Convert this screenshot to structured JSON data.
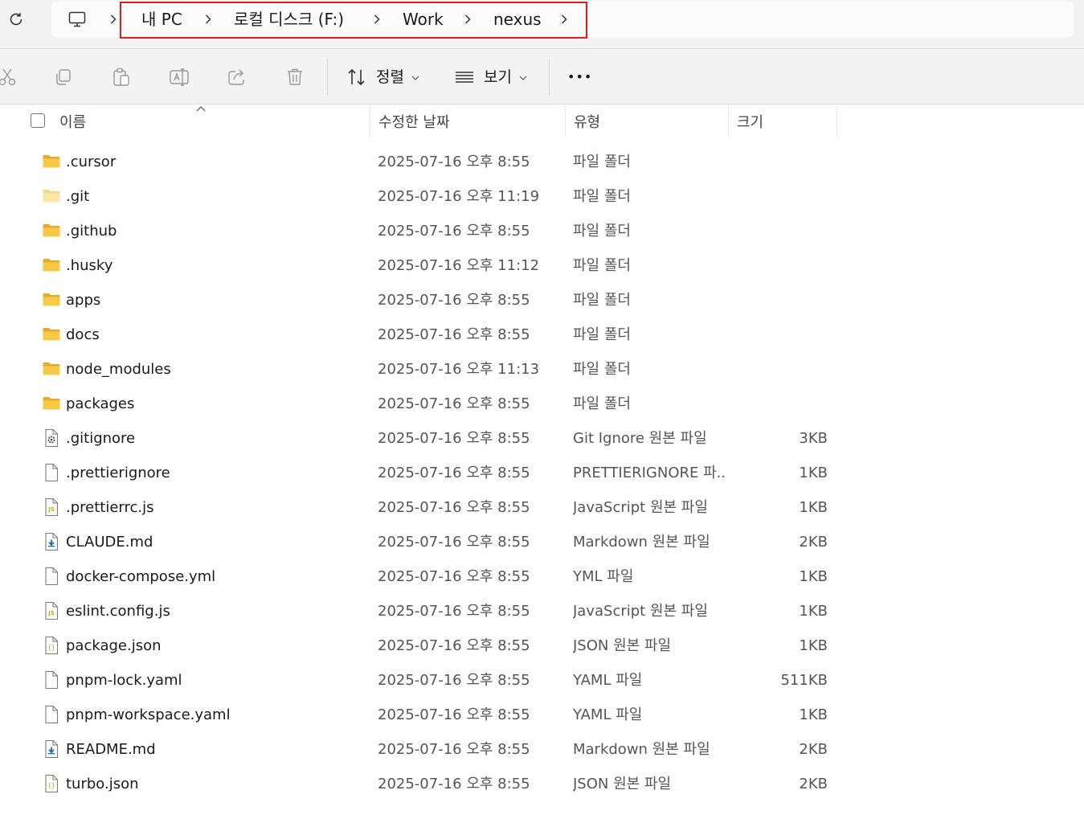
{
  "breadcrumb": {
    "items": [
      "내 PC",
      "로컬 디스크 (F:)",
      "Work",
      "nexus"
    ]
  },
  "icons": {
    "refresh": "refresh-icon",
    "pc": "computer-icon",
    "cut": "cut-icon",
    "copy": "copy-icon",
    "paste": "paste-icon",
    "rename": "rename-icon",
    "share": "share-icon",
    "delete": "delete-icon",
    "sort": "sort-icon",
    "view": "view-list-icon",
    "more": "more-icon"
  },
  "toolbar": {
    "sort_label": "정렬",
    "view_label": "보기",
    "more_label": "•••"
  },
  "columns": {
    "name": "이름",
    "modified": "수정한 날짜",
    "type": "유형",
    "size": "크기"
  },
  "colors": {
    "folder": "#f4c542",
    "highlight": "#e31a1a"
  },
  "files": [
    {
      "name": ".cursor",
      "date": "2025-07-16 오후 8:55",
      "type": "파일 폴더",
      "size": "",
      "icon": "folder-icon"
    },
    {
      "name": ".git",
      "date": "2025-07-16 오후 11:19",
      "type": "파일 폴더",
      "size": "",
      "icon": "folder-hidden-icon"
    },
    {
      "name": ".github",
      "date": "2025-07-16 오후 8:55",
      "type": "파일 폴더",
      "size": "",
      "icon": "folder-icon"
    },
    {
      "name": ".husky",
      "date": "2025-07-16 오후 11:12",
      "type": "파일 폴더",
      "size": "",
      "icon": "folder-icon"
    },
    {
      "name": "apps",
      "date": "2025-07-16 오후 8:55",
      "type": "파일 폴더",
      "size": "",
      "icon": "folder-icon"
    },
    {
      "name": "docs",
      "date": "2025-07-16 오후 8:55",
      "type": "파일 폴더",
      "size": "",
      "icon": "folder-icon"
    },
    {
      "name": "node_modules",
      "date": "2025-07-16 오후 11:13",
      "type": "파일 폴더",
      "size": "",
      "icon": "folder-icon"
    },
    {
      "name": "packages",
      "date": "2025-07-16 오후 8:55",
      "type": "파일 폴더",
      "size": "",
      "icon": "folder-icon"
    },
    {
      "name": ".gitignore",
      "date": "2025-07-16 오후 8:55",
      "type": "Git Ignore 원본 파일",
      "size": "3KB",
      "icon": "settings-file-icon"
    },
    {
      "name": ".prettierignore",
      "date": "2025-07-16 오후 8:55",
      "type": "PRETTIERIGNORE 파...",
      "size": "1KB",
      "icon": "file-icon"
    },
    {
      "name": ".prettierrc.js",
      "date": "2025-07-16 오후 8:55",
      "type": "JavaScript 원본 파일",
      "size": "1KB",
      "icon": "js-file-icon"
    },
    {
      "name": "CLAUDE.md",
      "date": "2025-07-16 오후 8:55",
      "type": "Markdown 원본 파일",
      "size": "2KB",
      "icon": "markdown-file-icon"
    },
    {
      "name": "docker-compose.yml",
      "date": "2025-07-16 오후 8:55",
      "type": "YML 파일",
      "size": "1KB",
      "icon": "file-icon"
    },
    {
      "name": "eslint.config.js",
      "date": "2025-07-16 오후 8:55",
      "type": "JavaScript 원본 파일",
      "size": "1KB",
      "icon": "js-file-icon"
    },
    {
      "name": "package.json",
      "date": "2025-07-16 오후 8:55",
      "type": "JSON 원본 파일",
      "size": "1KB",
      "icon": "json-file-icon"
    },
    {
      "name": "pnpm-lock.yaml",
      "date": "2025-07-16 오후 8:55",
      "type": "YAML 파일",
      "size": "511KB",
      "icon": "file-icon"
    },
    {
      "name": "pnpm-workspace.yaml",
      "date": "2025-07-16 오후 8:55",
      "type": "YAML 파일",
      "size": "1KB",
      "icon": "file-icon"
    },
    {
      "name": "README.md",
      "date": "2025-07-16 오후 8:55",
      "type": "Markdown 원본 파일",
      "size": "2KB",
      "icon": "markdown-file-icon"
    },
    {
      "name": "turbo.json",
      "date": "2025-07-16 오후 8:55",
      "type": "JSON 원본 파일",
      "size": "2KB",
      "icon": "json-file-icon"
    }
  ]
}
